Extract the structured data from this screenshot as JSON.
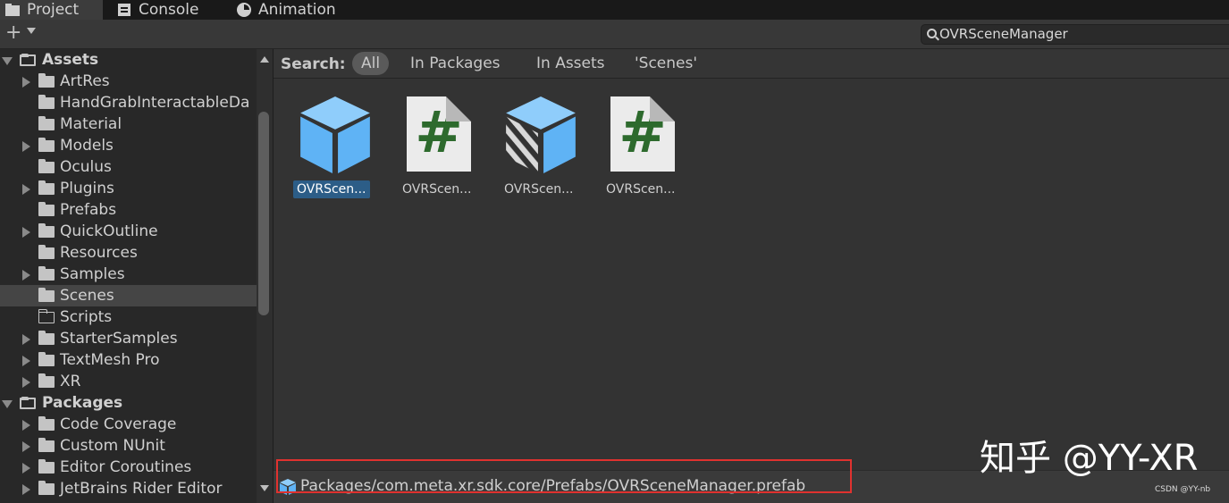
{
  "tabs": [
    {
      "label": "Project",
      "icon": "folder-icon"
    },
    {
      "label": "Console",
      "icon": "console-icon"
    },
    {
      "label": "Animation",
      "icon": "clock-icon"
    }
  ],
  "toolbar": {
    "add_label": "+"
  },
  "search": {
    "value": "OVRSceneManager"
  },
  "tree": {
    "assets_label": "Assets",
    "asset_folders": [
      {
        "label": "ArtRes",
        "expandable": true
      },
      {
        "label": "HandGrabInteractableDa",
        "expandable": false
      },
      {
        "label": "Material",
        "expandable": false
      },
      {
        "label": "Models",
        "expandable": true
      },
      {
        "label": "Oculus",
        "expandable": false
      },
      {
        "label": "Plugins",
        "expandable": true
      },
      {
        "label": "Prefabs",
        "expandable": false
      },
      {
        "label": "QuickOutline",
        "expandable": true
      },
      {
        "label": "Resources",
        "expandable": false
      },
      {
        "label": "Samples",
        "expandable": true
      },
      {
        "label": "Scenes",
        "expandable": false,
        "selected": true
      },
      {
        "label": "Scripts",
        "expandable": false
      },
      {
        "label": "StarterSamples",
        "expandable": true
      },
      {
        "label": "TextMesh Pro",
        "expandable": true
      },
      {
        "label": "XR",
        "expandable": true
      }
    ],
    "packages_label": "Packages",
    "package_folders": [
      {
        "label": "Code Coverage"
      },
      {
        "label": "Custom NUnit"
      },
      {
        "label": "Editor Coroutines"
      },
      {
        "label": "JetBrains Rider Editor"
      }
    ]
  },
  "filter": {
    "search_label": "Search:",
    "chips": [
      "All",
      "In Packages",
      "In Assets",
      "'Scenes'"
    ]
  },
  "assets": [
    {
      "name": "OVRScen...",
      "type": "prefab",
      "selected": true
    },
    {
      "name": "OVRScen...",
      "type": "script"
    },
    {
      "name": "OVRScen...",
      "type": "prefab-variant"
    },
    {
      "name": "OVRScen...",
      "type": "script"
    }
  ],
  "status": {
    "path": "Packages/com.meta.xr.sdk.core/Prefabs/OVRSceneManager.prefab"
  },
  "watermark": {
    "text": "知乎 @YY-XR",
    "csdn": "CSDN @YY-nb"
  },
  "colors": {
    "selection": "#2c5d87",
    "highlight_box": "#e0322f",
    "script_hash": "#2d6a2d",
    "prefab_blue": "#5fb3f5"
  }
}
